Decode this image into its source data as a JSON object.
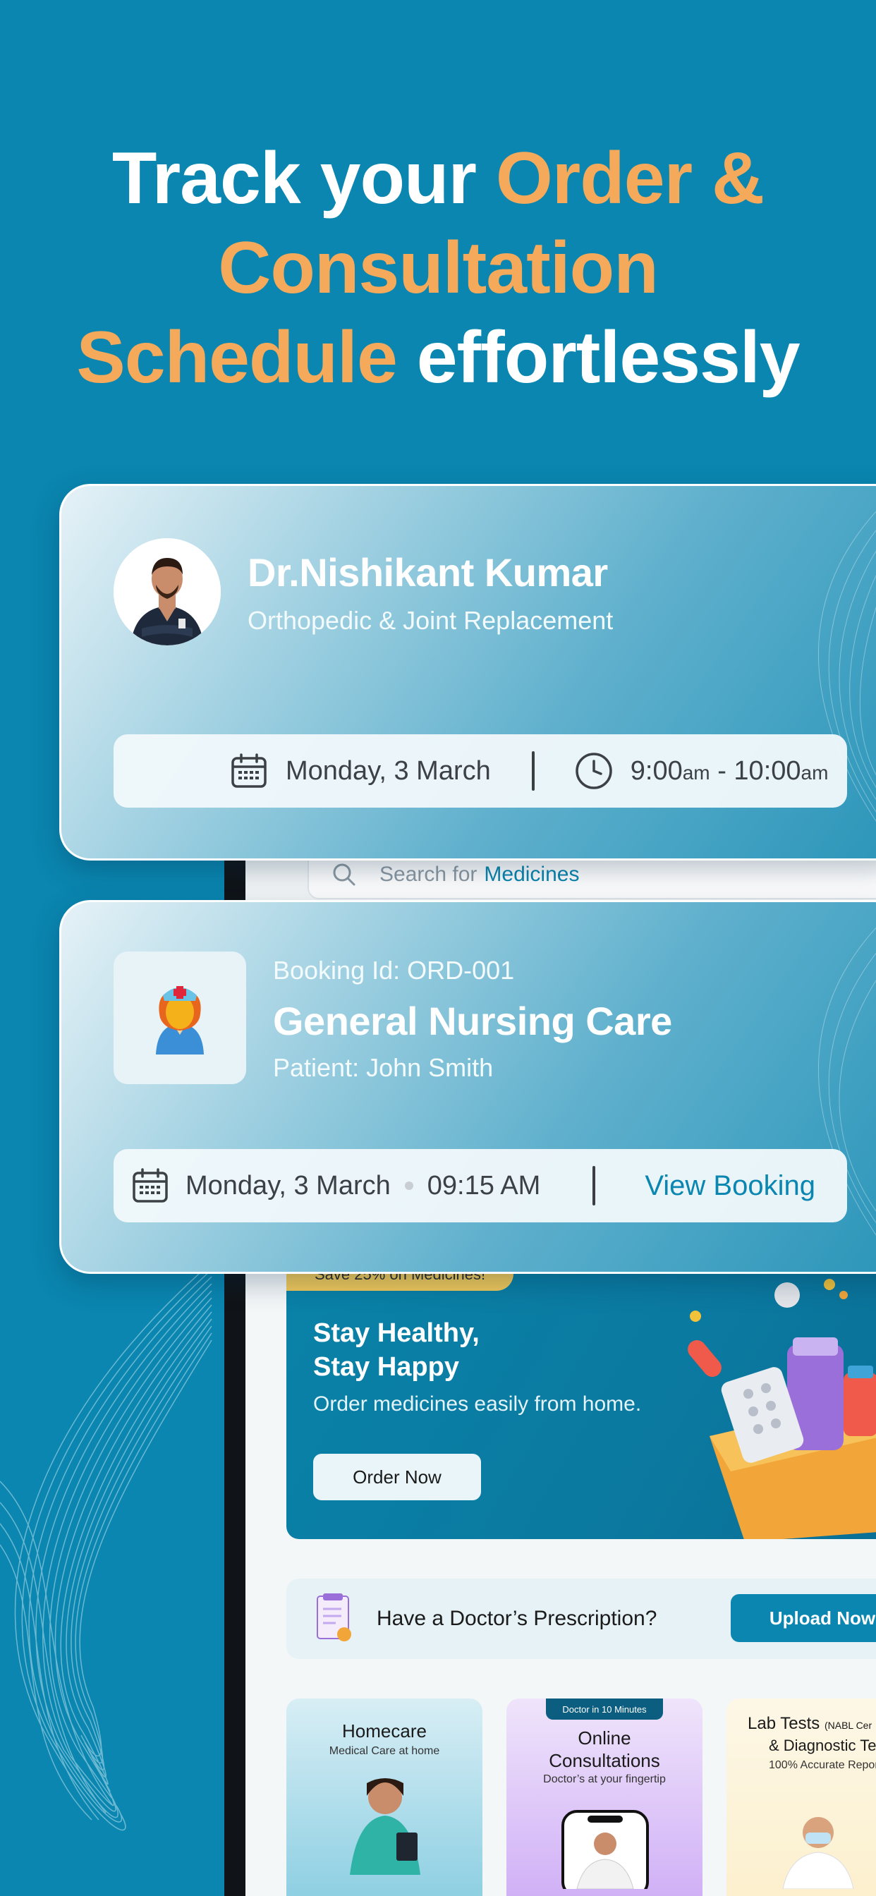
{
  "headline": {
    "part1": "Track your ",
    "part2": "Order &",
    "part3": "Consultation",
    "part4": "Schedule",
    "part5": " effortlessly"
  },
  "appointment_card": {
    "doctor_name": "Dr.Nishikant Kumar",
    "specialty": "Orthopedic & Joint Replacement",
    "date": "Monday, 3 March",
    "time_start": "9:00",
    "time_start_suffix": "am",
    "time_separator": " - ",
    "time_end": "10:00",
    "time_end_suffix": "am"
  },
  "booking_card": {
    "booking_id": "Booking Id: ORD-001",
    "service": "General Nursing Care",
    "patient": "Patient: John Smith",
    "date": "Monday, 3 March",
    "time": "09:15 AM",
    "action_label": "View Booking"
  },
  "app": {
    "search": {
      "prefix": "Search for",
      "highlight": "Medicines"
    },
    "promo": {
      "badge": "Save 25% on Medicines!",
      "title": "Stay Healthy,\nStay Happy",
      "subtitle": "Order medicines easily from home.",
      "button": "Order Now"
    },
    "prescription": {
      "text": "Have a Doctor’s Prescription?",
      "button": "Upload Now"
    },
    "services": [
      {
        "title": "Homecare",
        "subtitle": "Medical Care at home"
      },
      {
        "tag": "Doctor in 10 Minutes",
        "title": "Online\nConsultations",
        "subtitle": "Doctor’s at your fingertip"
      },
      {
        "title": "Lab Tests",
        "title_note": "(NABL Cer",
        "title2": "& Diagnostic Tes",
        "subtitle": "100% Accurate Repor"
      }
    ]
  },
  "colors": {
    "background": "#0a86b0",
    "accent_orange": "#f5a95a",
    "primary_blue": "#0a86b0"
  },
  "icons": [
    "calendar-icon",
    "clock-icon",
    "search-icon",
    "nurse-icon",
    "prescription-icon"
  ]
}
